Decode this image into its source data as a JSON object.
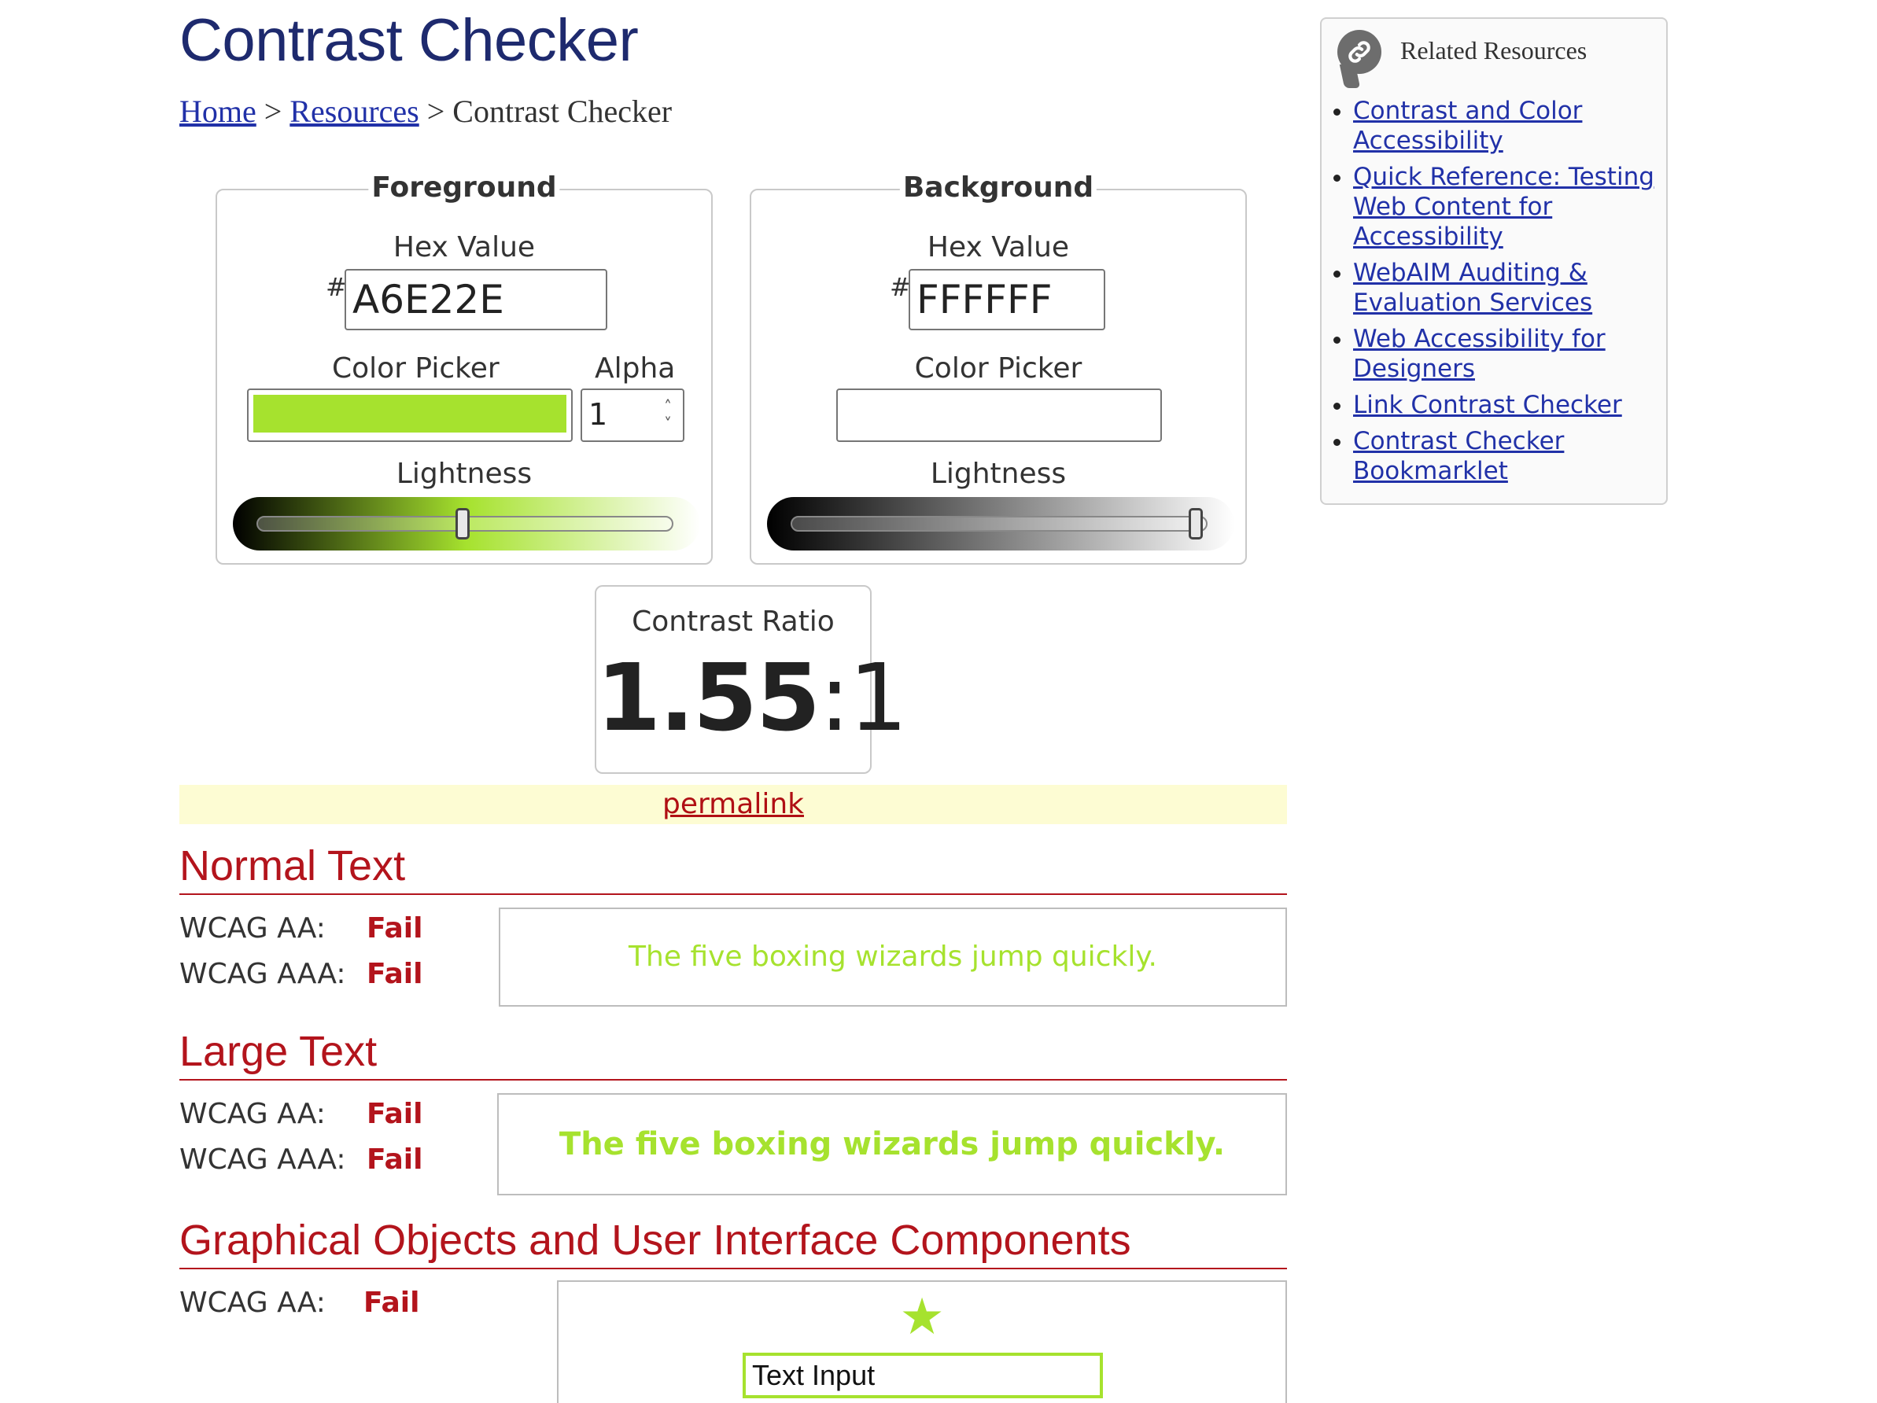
{
  "page": {
    "title": "Contrast Checker",
    "breadcrumb": {
      "home": "Home",
      "sep1": ">",
      "resources": "Resources",
      "sep2": ">",
      "current": "Contrast Checker"
    }
  },
  "foreground": {
    "legend": "Foreground",
    "hex_label": "Hex Value",
    "hash": "#",
    "hex_value": "A6E22E",
    "picker_label": "Color Picker",
    "alpha_label": "Alpha",
    "alpha_value": "1",
    "lightness_label": "Lightness",
    "lightness_level": 0.5,
    "color": "#A6E22E"
  },
  "background": {
    "legend": "Background",
    "hex_label": "Hex Value",
    "hash": "#",
    "hex_value": "FFFFFF",
    "picker_label": "Color Picker",
    "lightness_label": "Lightness",
    "lightness_level": 1.0,
    "color": "#FFFFFF"
  },
  "contrast": {
    "label": "Contrast Ratio",
    "ratio": "1.55",
    "suffix": ":1"
  },
  "permalink": "permalink",
  "normal_text": {
    "heading": "Normal Text",
    "aa_label": "WCAG AA:",
    "aa_result": "Fail",
    "aaa_label": "WCAG AAA:",
    "aaa_result": "Fail",
    "sample": "The five boxing wizards jump quickly."
  },
  "large_text": {
    "heading": "Large Text",
    "aa_label": "WCAG AA:",
    "aa_result": "Fail",
    "aaa_label": "WCAG AAA:",
    "aaa_result": "Fail",
    "sample": "The five boxing wizards jump quickly."
  },
  "graphical": {
    "heading": "Graphical Objects and User Interface Components",
    "aa_label": "WCAG AA:",
    "aa_result": "Fail",
    "star": "★",
    "input_value": "Text Input"
  },
  "sidebar": {
    "title": "Related Resources",
    "links": [
      "Contrast and Color Accessibility",
      "Quick Reference: Testing Web Content for Accessibility",
      "WebAIM Auditing & Evaluation Services",
      "Web Accessibility for Designers",
      "Link Contrast Checker",
      "Contrast Checker Bookmarklet"
    ]
  },
  "colors": {
    "title": "#1E2A6E",
    "link": "#2131A8",
    "fail": "#B3141C",
    "sample_fg": "#A6E22E"
  }
}
